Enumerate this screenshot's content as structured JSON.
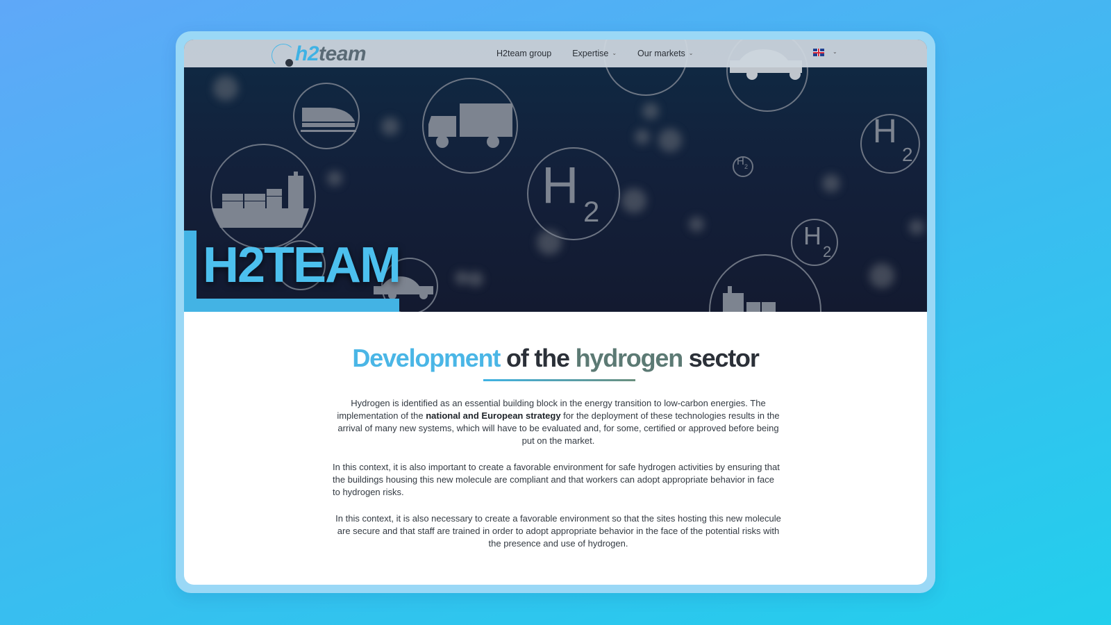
{
  "nav": {
    "logo_prefix": "h2",
    "logo_suffix": "team",
    "links": [
      {
        "label": "H2team group",
        "has_dropdown": false
      },
      {
        "label": "Expertise",
        "has_dropdown": true
      },
      {
        "label": "Our markets",
        "has_dropdown": true
      }
    ],
    "language_icon": "uk-flag-icon"
  },
  "hero": {
    "title": "H2TEAM",
    "h2_symbol": "H",
    "h2_subscript": "2",
    "accent_color": "#43b3e4"
  },
  "section": {
    "heading_part1": "Development",
    "heading_part2": " of the ",
    "heading_part3": "hydrogen",
    "heading_part4": " sector",
    "p1_before": "Hydrogen is identified as an essential building block in the energy transition to low-carbon energies. The implementation of the ",
    "p1_bold": "national and European strategy",
    "p1_after": " for the deployment of these technologies results in the arrival of many new systems, which will have to be evaluated and, for some, certified or approved before being put on the market.",
    "p2": "In this context, it is also important to create a favorable environment for safe hydrogen activities by ensuring that the buildings housing this new molecule are compliant and that workers can adopt appropriate behavior in face to hydrogen risks.",
    "p3": "In this context, it is also necessary to create a favorable environment so that the sites hosting this new molecule are secure and that staff are trained in order to adopt appropriate behavior in the face of the potential risks with the presence and use of hydrogen."
  },
  "colors": {
    "brand_blue": "#4ab6e6",
    "brand_green": "#5c7a74",
    "background_gradient_start": "#5fa8f8",
    "background_gradient_end": "#22cfec"
  }
}
